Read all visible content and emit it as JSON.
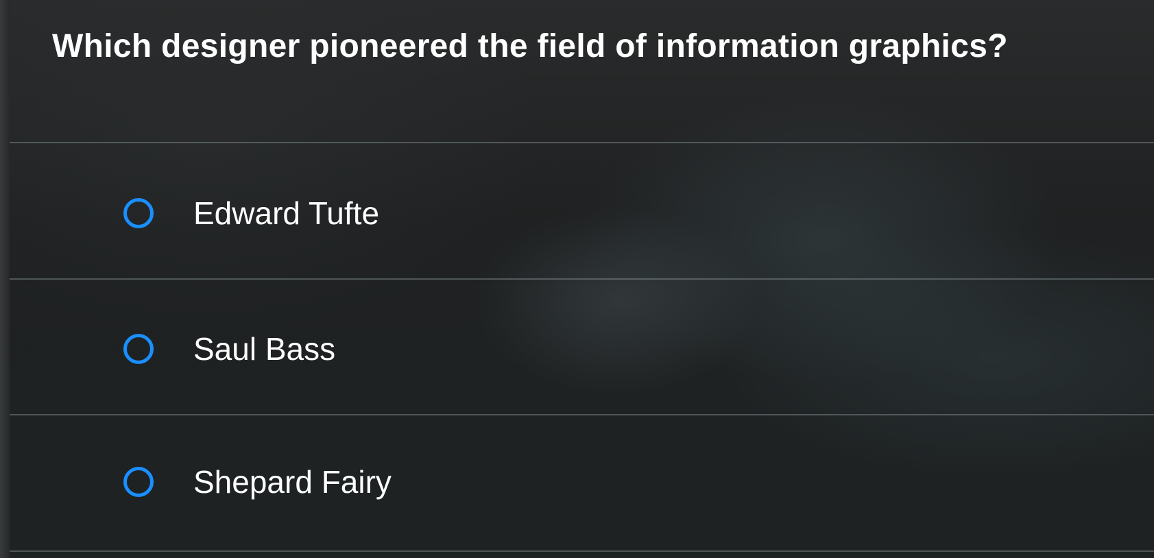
{
  "question": {
    "text": "Which designer pioneered the field of information graphics?"
  },
  "options": [
    {
      "label": "Edward Tufte",
      "selected": false
    },
    {
      "label": "Saul Bass",
      "selected": false
    },
    {
      "label": "Shepard Fairy",
      "selected": false
    }
  ],
  "colors": {
    "radio_accent": "#1a8fff",
    "text": "#ffffff",
    "background": "#1f2122"
  }
}
